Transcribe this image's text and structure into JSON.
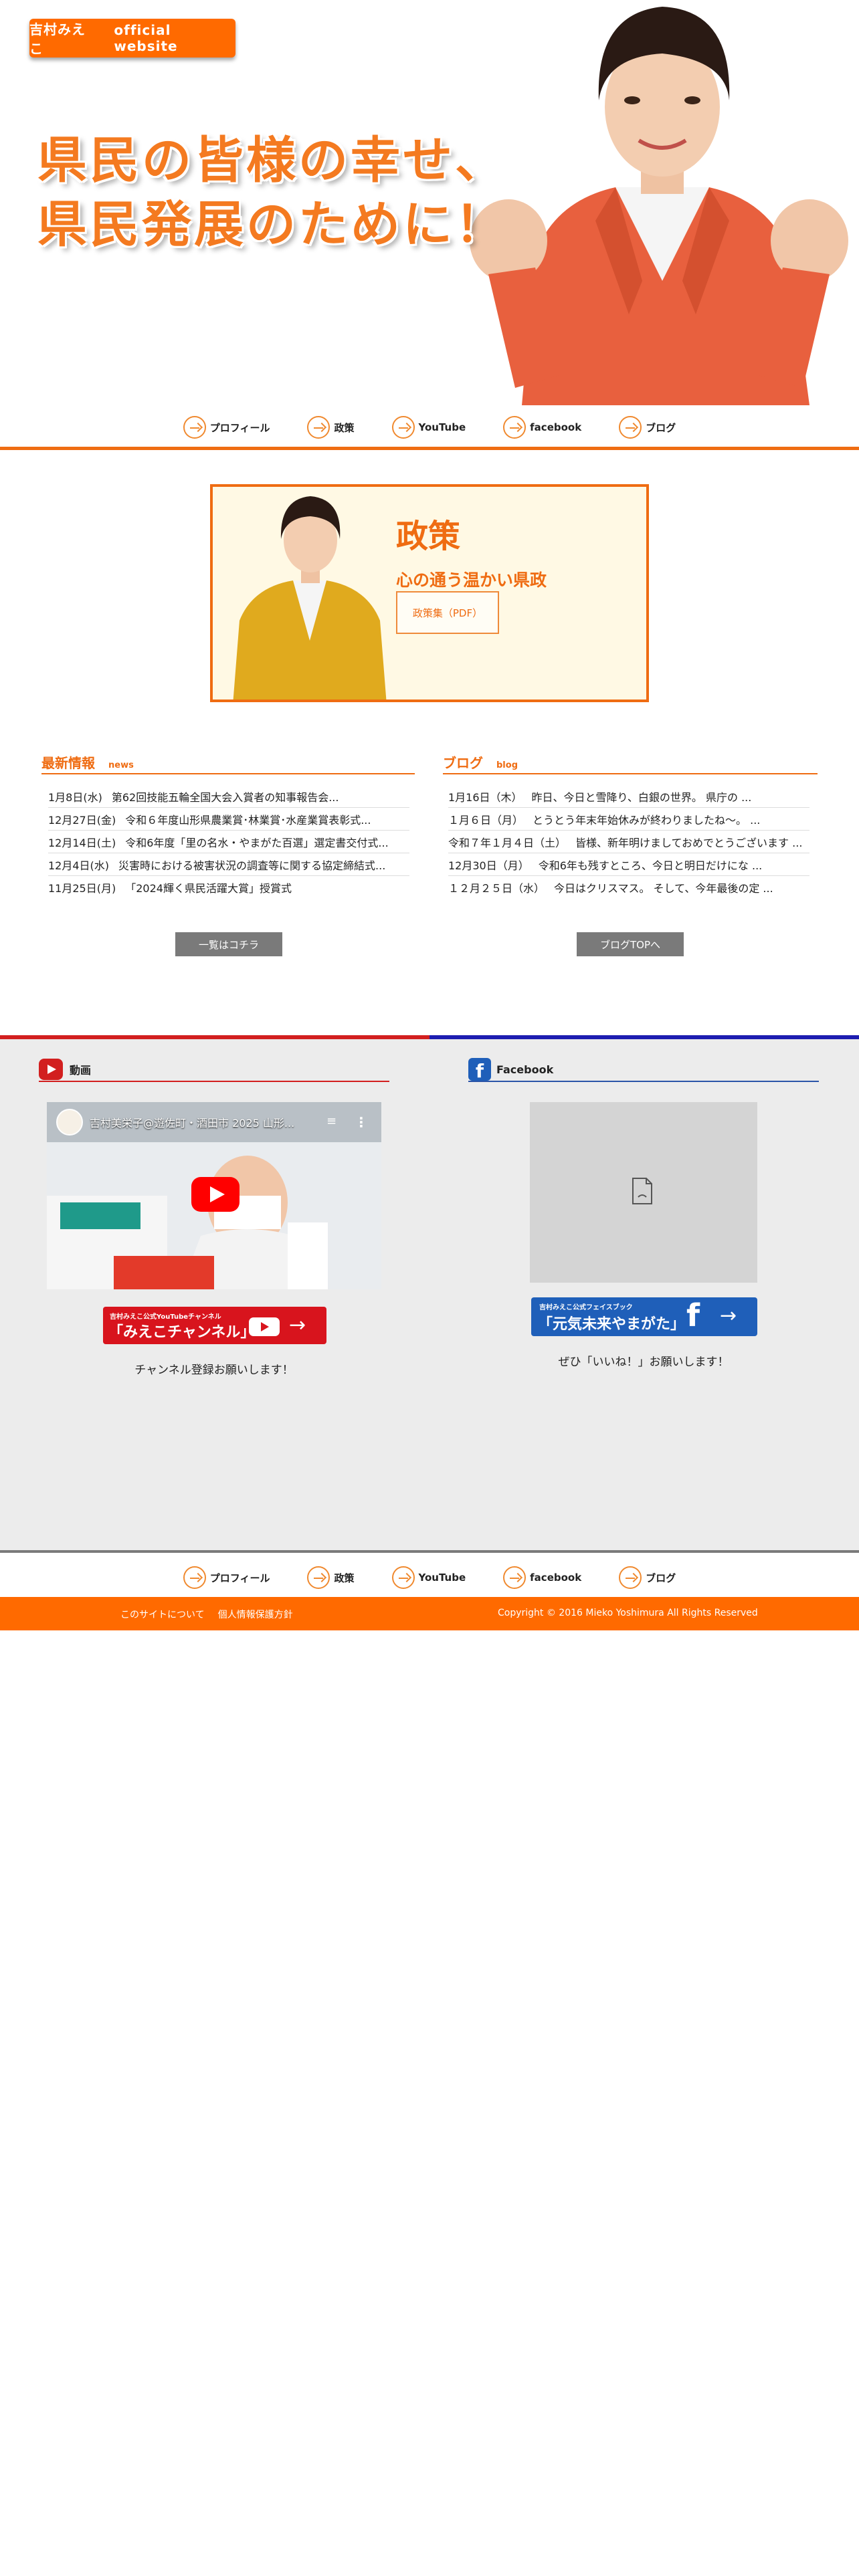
{
  "site": {
    "badge_name": "吉村みえこ",
    "badge_sub": "official website",
    "slogan_line1": "県民の皆様の幸せ、",
    "slogan_line2": "県民発展のために！"
  },
  "nav": {
    "items": [
      "プロフィール",
      "政策",
      "YouTube",
      "facebook",
      "ブログ"
    ]
  },
  "policy": {
    "title": "政策",
    "subtitle": "心の通う温かい県政",
    "pdf_label": "政策集（PDF）"
  },
  "news": {
    "title": "最新情報",
    "title_en": "news",
    "items": [
      {
        "date": "1月8日(水)",
        "text": "第62回技能五輪全国大会入賞者の知事報告会..."
      },
      {
        "date": "12月27日(金)",
        "text": "令和６年度山形県農業賞･林業賞･水産業賞表彰式..."
      },
      {
        "date": "12月14日(土)",
        "text": "令和6年度「里の名水・やまがた百選」選定書交付式..."
      },
      {
        "date": "12月4日(水)",
        "text": "災害時における被害状況の調査等に関する協定締結式..."
      },
      {
        "date": "11月25日(月)",
        "text": "「2024輝く県民活躍大賞」授賞式"
      }
    ],
    "more_label": "一覧はコチラ"
  },
  "blog": {
    "title": "ブログ",
    "title_en": "blog",
    "items": [
      {
        "date": "1月16日（木）",
        "text": "昨日、今日と雪降り、白銀の世界。 県庁の ..."
      },
      {
        "date": "１月６日（月）",
        "text": "とうとう年末年始休みが終わりましたね〜。 ..."
      },
      {
        "date": "令和７年１月４日（土）",
        "text": "皆様、新年明けましておめでとうございます ..."
      },
      {
        "date": "12月30日（月）",
        "text": "令和6年も残すところ、今日と明日だけにな ..."
      },
      {
        "date": "１２月２５日（水）",
        "text": "今日はクリスマス。 そして、今年最後の定 ..."
      }
    ],
    "more_label": "ブログTOPへ"
  },
  "youtube": {
    "heading": "動画",
    "video_title": "吉村美栄子@遊佐町・酒田市 2025 山形...",
    "banner_small": "吉村みえこ公式YouTubeチャンネル",
    "banner_big": "「みえこチャンネル」",
    "caption": "チャンネル登録お願いします！"
  },
  "facebook": {
    "heading": "Facebook",
    "banner_small": "吉村みえこ公式フェイスブック",
    "banner_big": "「元気未来やまがた」",
    "caption": "ぜひ「いいね！」お願いします！"
  },
  "footer": {
    "links": [
      "このサイトについて",
      "個人情報保護方針"
    ],
    "copyright": "Copyright © 2016 Mieko Yoshimura All Rights Reserved"
  },
  "colors": {
    "accent": "#ef6c12",
    "footer_bg": "#ff6a00",
    "youtube_red": "#d21f1f",
    "facebook_blue": "#1f5fb9",
    "social_bg": "#ececec"
  }
}
